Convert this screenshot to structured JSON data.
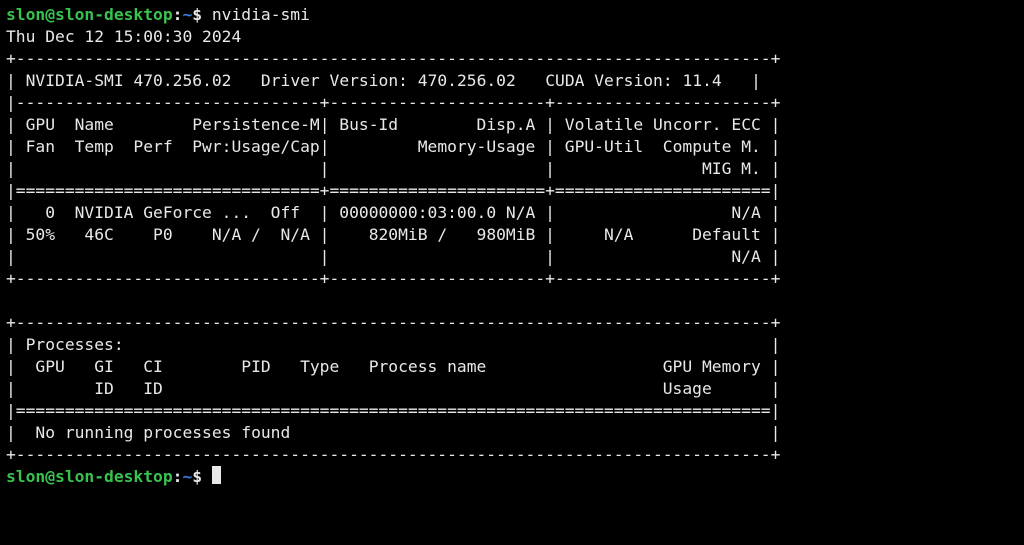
{
  "prompt": {
    "user": "slon@slon-desktop",
    "colon": ":",
    "path": "~",
    "dollar": "$ ",
    "command": "nvidia-smi"
  },
  "timestamp": "Thu Dec 12 15:00:30 2024",
  "header": {
    "smi_label": "NVIDIA-SMI",
    "smi_ver": "470.256.02",
    "drv_label": "Driver Version:",
    "drv_ver": "470.256.02",
    "cuda_label": "CUDA Version:",
    "cuda_ver": "11.4"
  },
  "cols": {
    "r1c1": "GPU  Name        Persistence-M",
    "r1c2": "Bus-Id        Disp.A",
    "r1c3": "Volatile Uncorr. ECC",
    "r2c1": "Fan  Temp  Perf  Pwr:Usage/Cap",
    "r2c2": "        Memory-Usage",
    "r2c3": "GPU-Util  Compute M.",
    "r3c3": "              MIG M."
  },
  "row": {
    "l1c1": "  0  NVIDIA GeForce ...  Off ",
    "l1c2": "00000000:03:00.0 N/A",
    "l1c3": "                 N/A",
    "l2c1": "50%   46C    P0    N/A /  N/A",
    "l2c2": "   820MiB /   980MiB",
    "l2c3": "    N/A      Default",
    "l3c3": "                 N/A"
  },
  "proc": {
    "title": "Processes:",
    "hdr1": "GPU   GI   CI        PID   Type   Process name                  GPU Memory",
    "hdr2": "      ID   ID                                                   Usage     ",
    "none": "No running processes found"
  }
}
